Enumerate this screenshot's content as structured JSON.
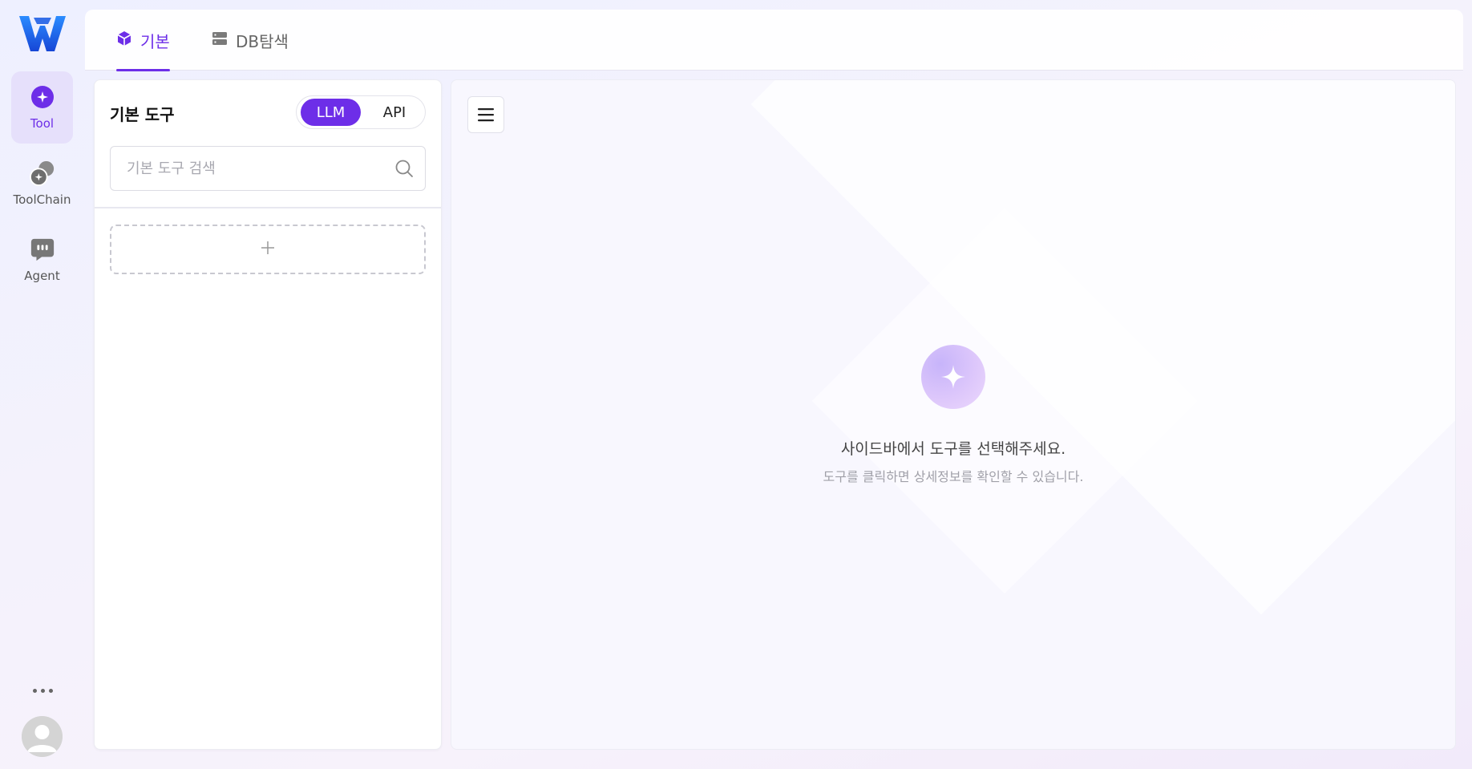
{
  "colors": {
    "accent": "#6d2ee8",
    "rail_active_bg": "#e6e0fb",
    "brand_blue": "#1a6ff0"
  },
  "rail": {
    "logo_icon": "w-logo-icon",
    "items": [
      {
        "label": "Tool",
        "icon": "sparkle-icon",
        "active": true
      },
      {
        "label": "ToolChain",
        "icon": "toolchain-icon",
        "active": false
      },
      {
        "label": "Agent",
        "icon": "agent-chat-icon",
        "active": false
      }
    ],
    "more_icon": "ellipsis-icon",
    "avatar_icon": "user-avatar-icon"
  },
  "tabs": [
    {
      "label": "기본",
      "icon": "cube-icon",
      "active": true
    },
    {
      "label": "DB탐색",
      "icon": "database-icon",
      "active": false
    }
  ],
  "left_panel": {
    "title": "기본 도구",
    "toggle": {
      "options": [
        "LLM",
        "API"
      ],
      "selected": "LLM"
    },
    "search": {
      "placeholder": "기본 도구 검색",
      "value": ""
    },
    "add_icon": "plus-icon"
  },
  "main": {
    "menu_icon": "hamburger-menu-icon",
    "empty_state": {
      "icon": "sparkle-icon",
      "title": "사이드바에서 도구를 선택해주세요.",
      "subtitle": "도구를 클릭하면 상세정보를 확인할 수 있습니다."
    }
  }
}
